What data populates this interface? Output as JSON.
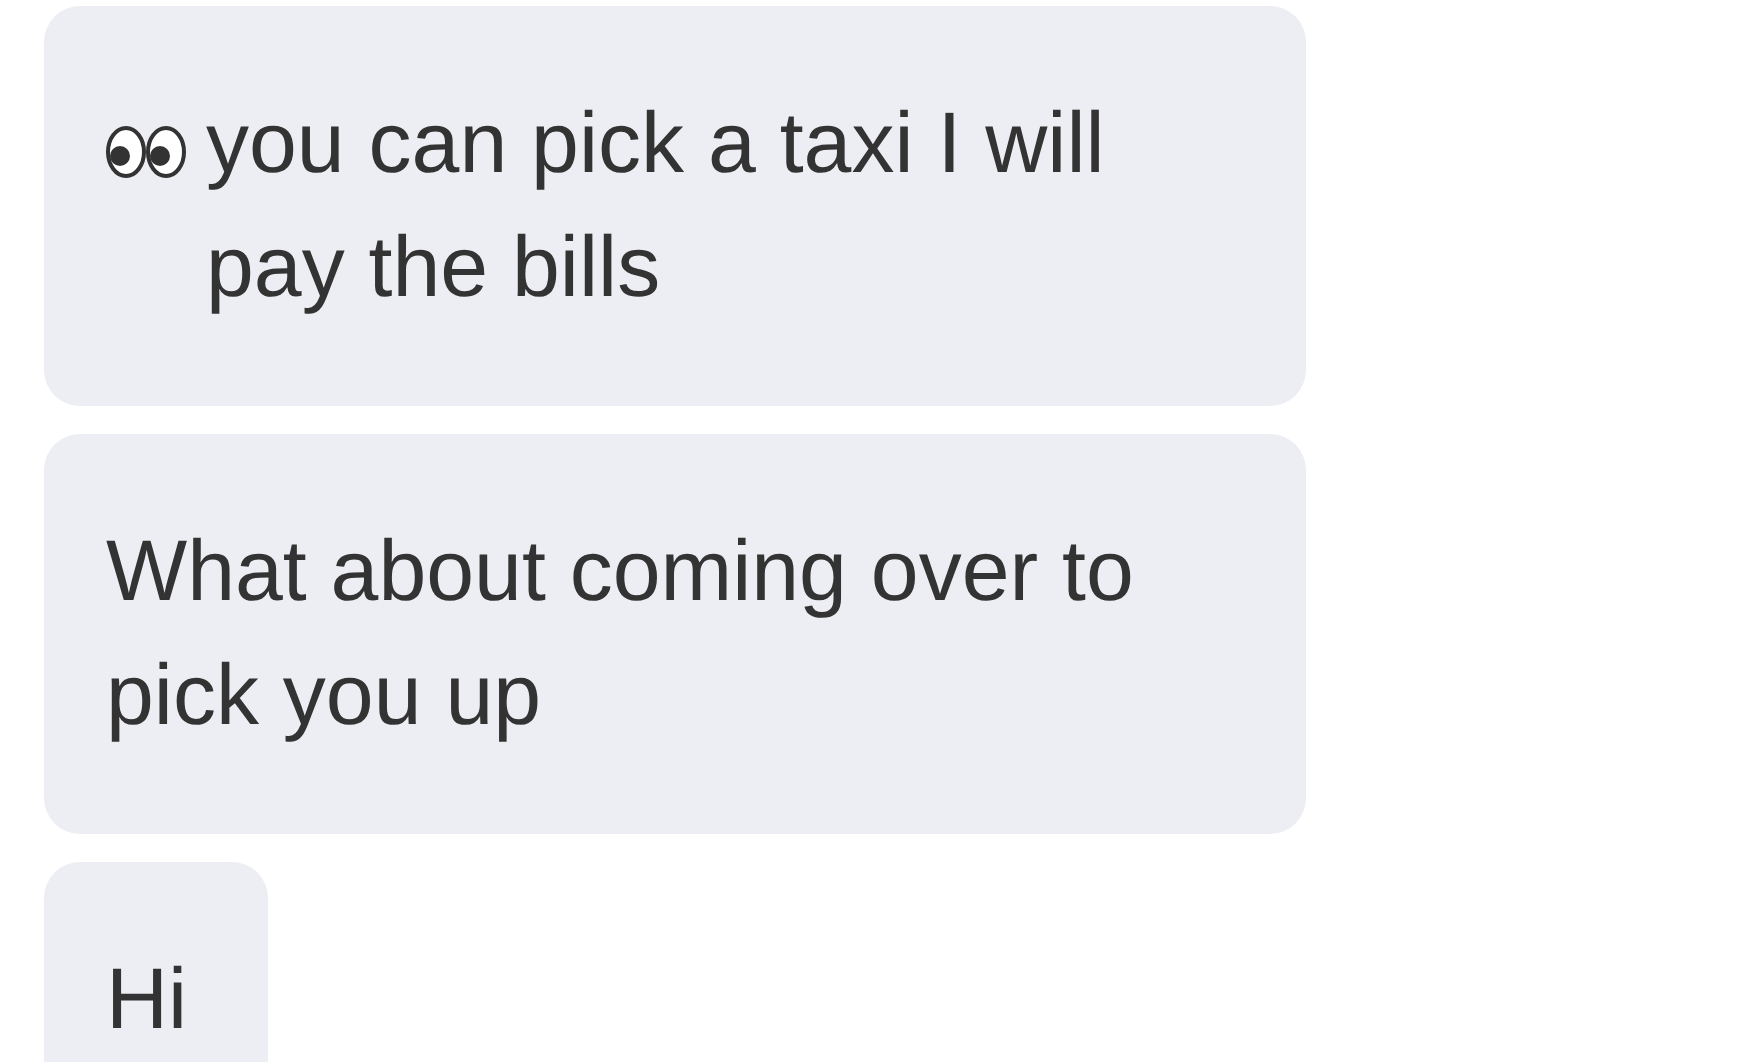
{
  "messages": [
    {
      "kind": "with_icon",
      "text": "you can pick a taxi I will pay the bills"
    },
    {
      "kind": "plain",
      "text": "What about coming over to pick you up"
    },
    {
      "kind": "plain",
      "text": "Hi"
    }
  ]
}
